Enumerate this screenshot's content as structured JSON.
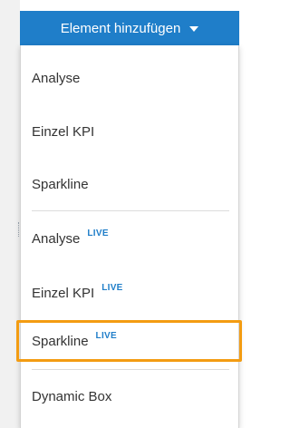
{
  "header": {
    "button_label": "Element hinzufügen"
  },
  "menu": {
    "items": [
      {
        "label": "Analyse",
        "badge": ""
      },
      {
        "label": "Einzel KPI",
        "badge": ""
      },
      {
        "label": "Sparkline",
        "badge": ""
      },
      {
        "label": "Analyse",
        "badge": "LIVE"
      },
      {
        "label": "Einzel KPI",
        "badge": "LIVE"
      },
      {
        "label": "Sparkline",
        "badge": "LIVE"
      },
      {
        "label": "Dynamic Box",
        "badge": ""
      }
    ],
    "highlighted_item": "Sparkline LIVE"
  },
  "colors": {
    "accent": "#1f7ec9",
    "highlight_border": "#f39c12",
    "text": "#333333"
  },
  "icons": {
    "dropdown": "caret-down-icon"
  }
}
